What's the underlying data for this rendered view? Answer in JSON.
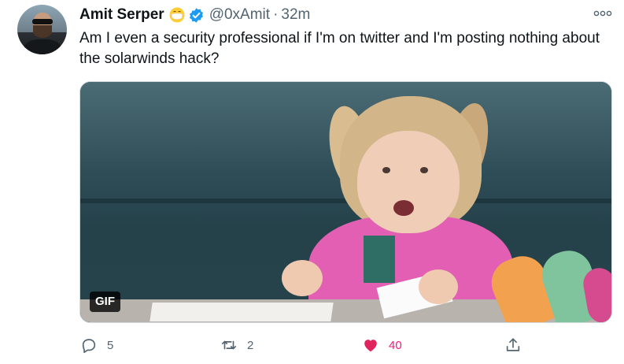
{
  "tweet": {
    "author_name": "Amit Serper",
    "handle": "@0xAmit",
    "separator": "·",
    "time": "32m",
    "text": "Am I even a security professional if I'm on twitter and I'm posting nothing about the solarwinds hack?",
    "media": {
      "badge": "GIF"
    },
    "actions": {
      "reply_count": "5",
      "retweet_count": "2",
      "like_count": "40"
    }
  },
  "colors": {
    "text_primary": "#0f1419",
    "text_secondary": "#536471",
    "verified": "#1d9bf0",
    "like": "#f91880"
  },
  "icons": {
    "emoji": "face-with-medical-mask-icon",
    "verified": "verified-badge-icon",
    "more": "more-options-icon",
    "reply": "reply-icon",
    "retweet": "retweet-icon",
    "like": "heart-filled-icon",
    "share": "share-icon"
  }
}
